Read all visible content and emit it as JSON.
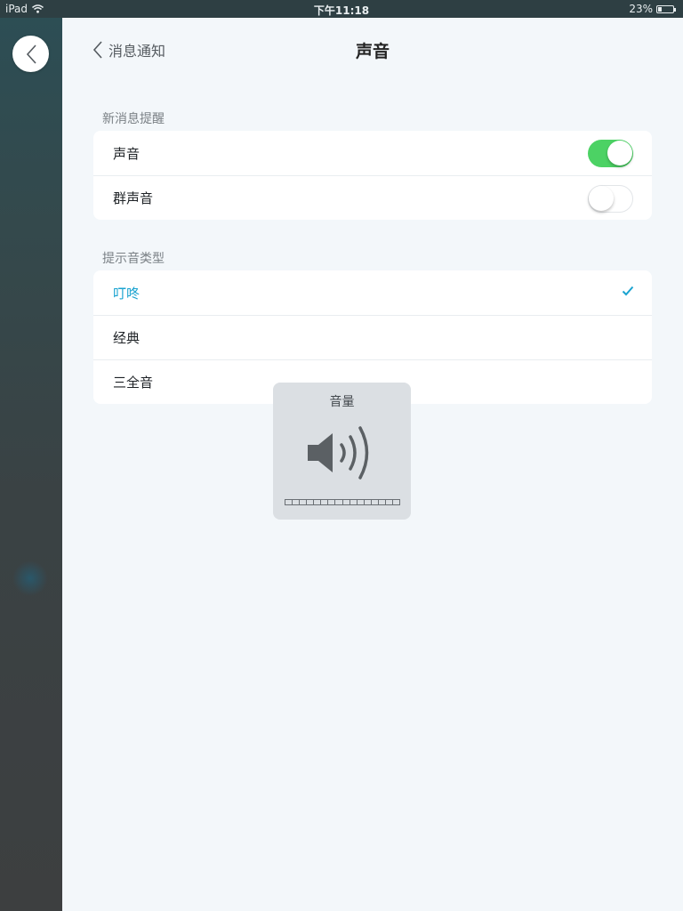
{
  "status_bar": {
    "device": "iPad",
    "time": "下午11:18",
    "battery": "23%"
  },
  "nav": {
    "back_label": "消息通知",
    "title": "声音"
  },
  "sections": {
    "new_message": {
      "label": "新消息提醒",
      "items": [
        {
          "label": "声音",
          "toggle": true
        },
        {
          "label": "群声音",
          "toggle": false
        }
      ]
    },
    "tone_type": {
      "label": "提示音类型",
      "items": [
        {
          "label": "叮咚",
          "selected": true
        },
        {
          "label": "经典",
          "selected": false
        },
        {
          "label": "三全音",
          "selected": false
        }
      ]
    }
  },
  "volume_hud": {
    "title": "音量",
    "level": 0,
    "segments": 16
  },
  "colors": {
    "accent": "#1aa3d0",
    "toggle_on": "#4cd264"
  }
}
